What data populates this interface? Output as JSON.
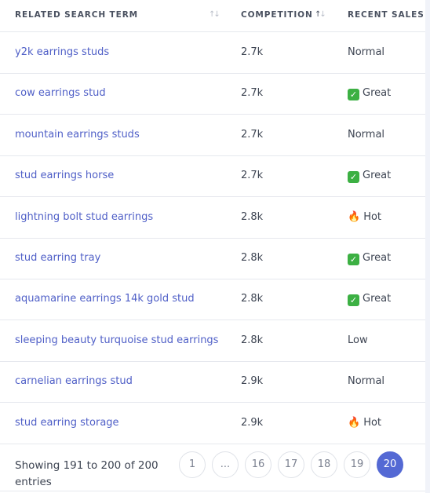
{
  "table": {
    "columns": [
      {
        "label": "RELATED SEARCH TERM",
        "sort": "none"
      },
      {
        "label": "COMPETITION",
        "sort": "ascending"
      },
      {
        "label": "RECENT SALES SI",
        "sort": "none"
      }
    ],
    "rows": [
      {
        "term": "y2k earrings studs",
        "competition": "2.7k",
        "signal": "Normal",
        "signal_icon": ""
      },
      {
        "term": "cow earrings stud",
        "competition": "2.7k",
        "signal": "Great",
        "signal_icon": "check-icon"
      },
      {
        "term": "mountain earrings studs",
        "competition": "2.7k",
        "signal": "Normal",
        "signal_icon": ""
      },
      {
        "term": "stud earrings horse",
        "competition": "2.7k",
        "signal": "Great",
        "signal_icon": "check-icon"
      },
      {
        "term": "lightning bolt stud earrings",
        "competition": "2.8k",
        "signal": "Hot",
        "signal_icon": "fire-icon"
      },
      {
        "term": "stud earring tray",
        "competition": "2.8k",
        "signal": "Great",
        "signal_icon": "check-icon"
      },
      {
        "term": "aquamarine earrings 14k gold stud",
        "competition": "2.8k",
        "signal": "Great",
        "signal_icon": "check-icon"
      },
      {
        "term": "sleeping beauty turquoise stud earrings",
        "competition": "2.8k",
        "signal": "Low",
        "signal_icon": ""
      },
      {
        "term": "carnelian earrings stud",
        "competition": "2.9k",
        "signal": "Normal",
        "signal_icon": ""
      },
      {
        "term": "stud earring storage",
        "competition": "2.9k",
        "signal": "Hot",
        "signal_icon": "fire-icon"
      }
    ]
  },
  "footer": {
    "showing_text": "Showing 191 to 200 of 200 entries",
    "pages": [
      "1",
      "...",
      "16",
      "17",
      "18",
      "19",
      "20"
    ],
    "active_page": "20"
  },
  "icons": {
    "sort": "↑↓",
    "check": "✓",
    "fire": "🔥"
  },
  "colors": {
    "link": "#4f5fc7",
    "accent": "#5469d4",
    "check_bg": "#3cb043"
  }
}
